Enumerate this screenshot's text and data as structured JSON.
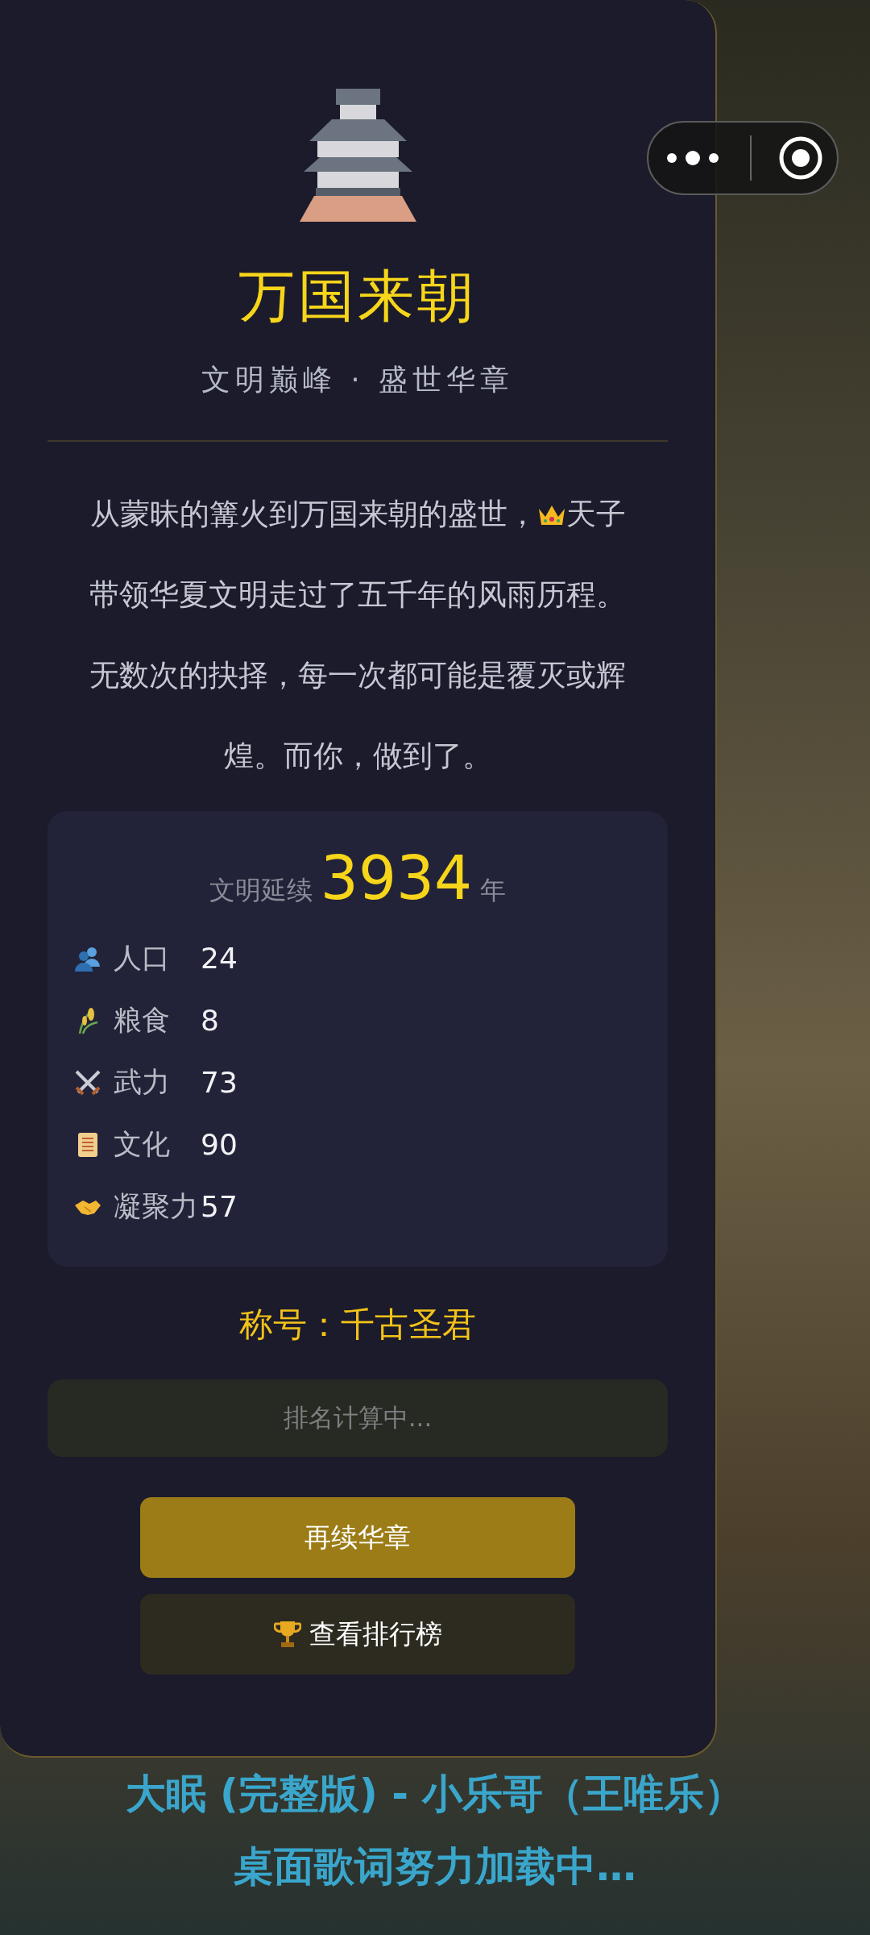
{
  "title": "万国来朝",
  "subtitle": "文明巅峰 · 盛世华章",
  "story": {
    "before": "从蒙昧的篝火到万国来朝的盛世，",
    "after": "天子",
    "lines": [
      "带领华夏文明走过了五千年的风雨历程。",
      "无数次的抉择，每一次都可能是覆灭或辉",
      "煌。而你，做到了。"
    ]
  },
  "stats": {
    "label": "文明延续",
    "value": "3934",
    "unit": "年",
    "items": [
      {
        "kind": "population",
        "label": "人口",
        "value": "24"
      },
      {
        "kind": "food",
        "label": "粮食",
        "value": "8"
      },
      {
        "kind": "military",
        "label": "武力",
        "value": "73"
      },
      {
        "kind": "culture",
        "label": "文化",
        "value": "90"
      },
      {
        "kind": "cohesion",
        "label": "凝聚力",
        "value": "57"
      }
    ]
  },
  "rank_title": "称号：千古圣君",
  "rank_status": "排名计算中...",
  "buttons": [
    {
      "kind": "primary",
      "label": "再续华章"
    },
    {
      "kind": "leaderboard",
      "label": "查看排行榜"
    }
  ],
  "lyrics": [
    "大眠 (完整版) - 小乐哥（王唯乐）",
    "桌面歌词努力加载中…"
  ]
}
